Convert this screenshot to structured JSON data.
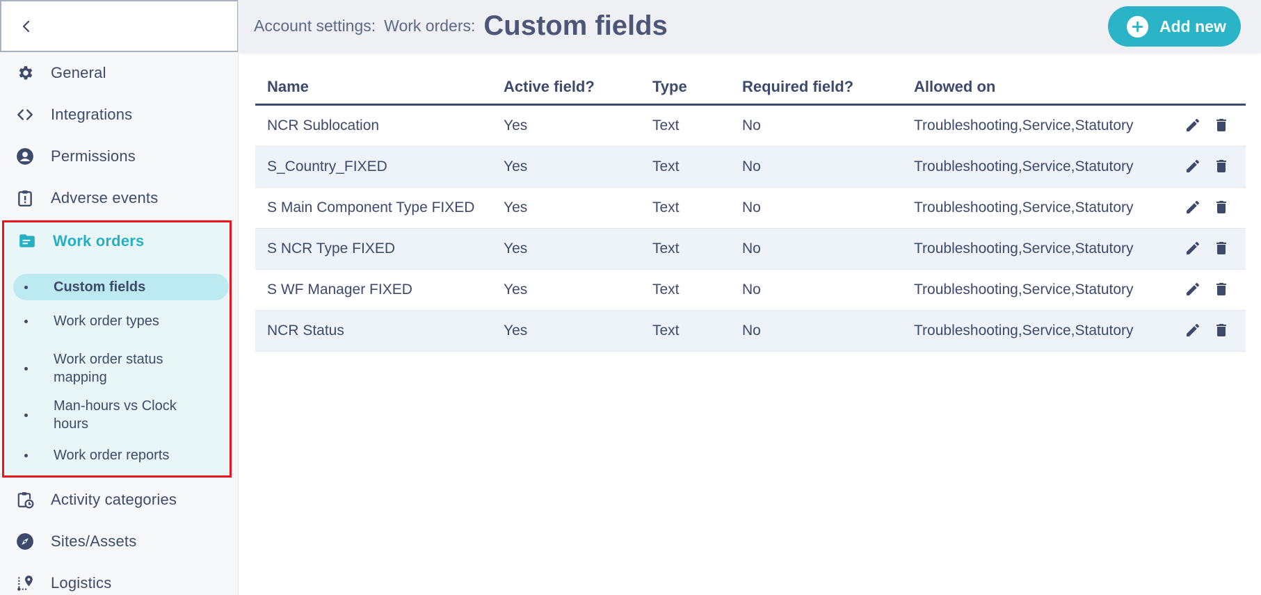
{
  "header": {
    "crumb1": "Account settings:",
    "crumb2": "Work orders:",
    "title": "Custom fields",
    "add_label": "Add new"
  },
  "sidebar": {
    "items": [
      {
        "label": "General",
        "icon": "gear-icon"
      },
      {
        "label": "Integrations",
        "icon": "code-icon"
      },
      {
        "label": "Permissions",
        "icon": "user-circle-icon"
      },
      {
        "label": "Adverse events",
        "icon": "clipboard-alert-icon"
      },
      {
        "label": "Work orders",
        "icon": "folder-icon"
      },
      {
        "label": "Activity categories",
        "icon": "clipboard-clock-icon"
      },
      {
        "label": "Sites/Assets",
        "icon": "compass-icon"
      },
      {
        "label": "Logistics",
        "icon": "route-pin-icon"
      }
    ],
    "sub_items": [
      {
        "label": "Custom fields"
      },
      {
        "label": "Work order types"
      },
      {
        "label": "Work order status mapping"
      },
      {
        "label": "Man-hours vs Clock hours"
      },
      {
        "label": "Work order reports"
      }
    ]
  },
  "table": {
    "columns": [
      "Name",
      "Active field?",
      "Type",
      "Required field?",
      "Allowed on"
    ],
    "rows": [
      {
        "name": "NCR Sublocation",
        "active": "Yes",
        "type": "Text",
        "required": "No",
        "allowed": "Troubleshooting,Service,Statutory"
      },
      {
        "name": "S_Country_FIXED",
        "active": "Yes",
        "type": "Text",
        "required": "No",
        "allowed": "Troubleshooting,Service,Statutory"
      },
      {
        "name": "S Main Component Type FIXED",
        "active": "Yes",
        "type": "Text",
        "required": "No",
        "allowed": "Troubleshooting,Service,Statutory"
      },
      {
        "name": "S NCR Type FIXED",
        "active": "Yes",
        "type": "Text",
        "required": "No",
        "allowed": "Troubleshooting,Service,Statutory"
      },
      {
        "name": "S WF Manager FIXED",
        "active": "Yes",
        "type": "Text",
        "required": "No",
        "allowed": "Troubleshooting,Service,Statutory"
      },
      {
        "name": "NCR Status",
        "active": "Yes",
        "type": "Text",
        "required": "No",
        "allowed": "Troubleshooting,Service,Statutory"
      }
    ]
  },
  "colors": {
    "accent": "#2bb3c8",
    "text": "#3d4a6b",
    "highlight_border": "#e8161c",
    "active_bg": "#e8f6f8",
    "active_sub_bg": "#bde9f0",
    "row_alt": "#eef2f9"
  }
}
